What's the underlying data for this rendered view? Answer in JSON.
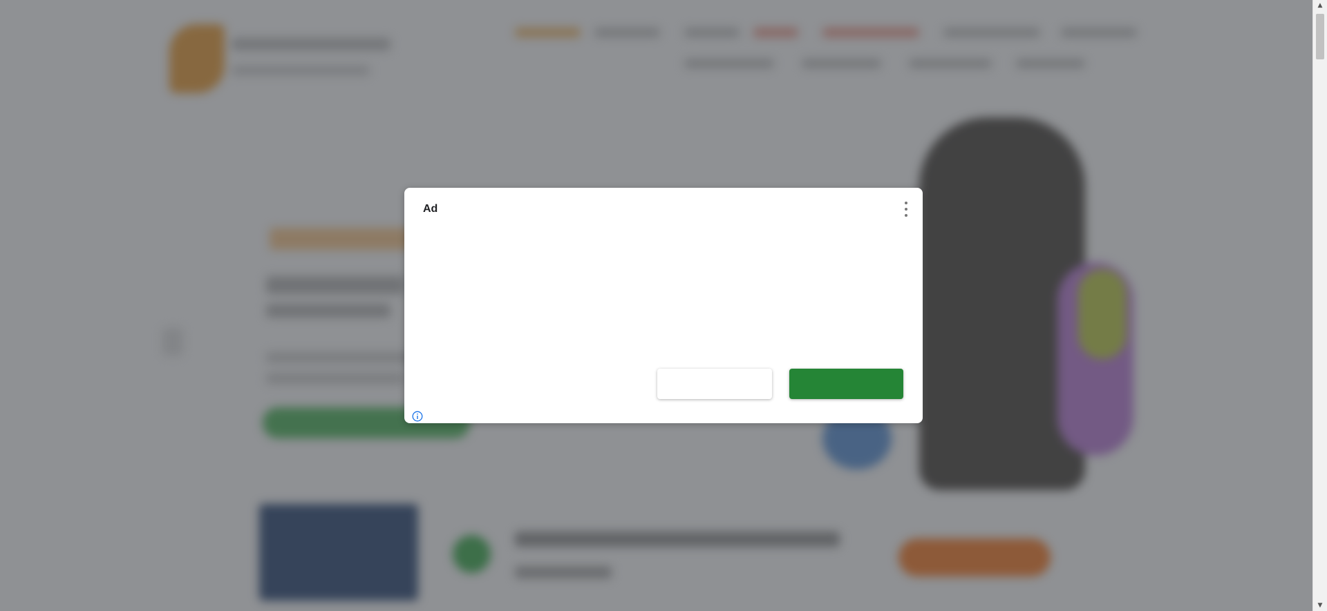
{
  "ad_dialog": {
    "label": "Ad",
    "secondary_button_label": "",
    "primary_button_label": "",
    "more_icon": "vertical-ellipsis-icon",
    "info_icon": "info-icon"
  },
  "colors": {
    "primary_button": "#258536",
    "info_icon": "#1a73e8",
    "overlay": "#3c4046"
  },
  "scrollbar": {
    "up_icon": "triangle-up-icon",
    "down_icon": "triangle-down-icon"
  }
}
